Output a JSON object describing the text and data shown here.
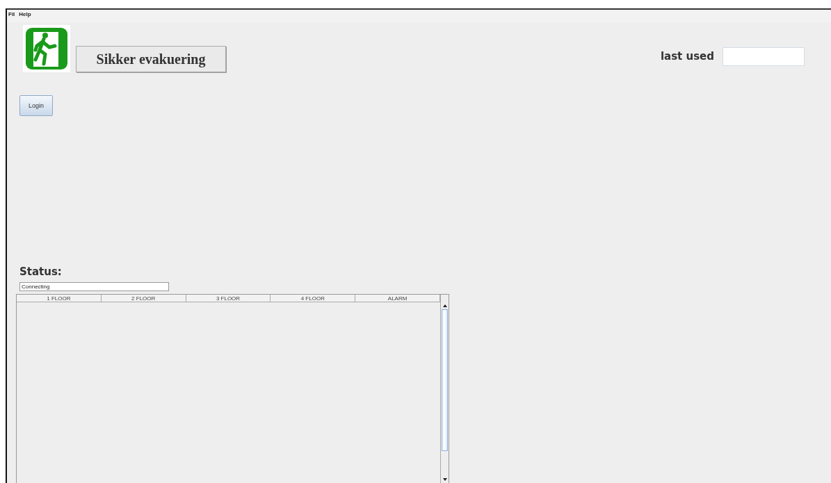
{
  "menu": [
    "Fil",
    "Help"
  ],
  "title": "Sikker evakuering",
  "last_used": {
    "label": "last used"
  },
  "login_button": "Login",
  "status": {
    "label": "Status:",
    "value": "Connecting"
  },
  "table": {
    "columns": [
      "1 FLOOR",
      "2 FLOOR",
      "3 FLOOR",
      "4 FLOOR",
      "ALARM"
    ]
  }
}
